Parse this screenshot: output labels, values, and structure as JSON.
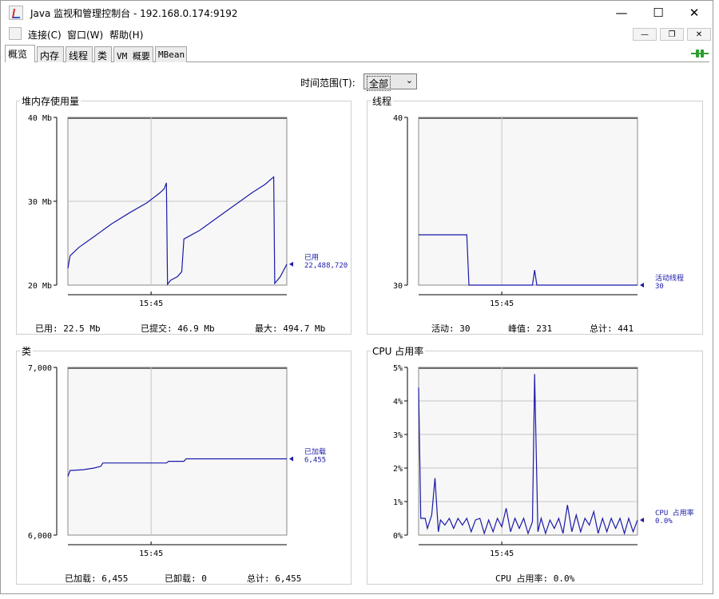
{
  "window": {
    "title": "Java 监视和管理控制台 - 192.168.0.174:9192"
  },
  "titlebar_buttons": {
    "minimize": "—",
    "maximize": "☐",
    "close": "✕"
  },
  "menu": {
    "connect": "连接(C)",
    "window": "窗口(W)",
    "help": "帮助(H)"
  },
  "mdi_buttons": {
    "minimize": "—",
    "restore": "❐",
    "close": "✕"
  },
  "tabs": [
    {
      "label": "概览",
      "active": true
    },
    {
      "label": "内存",
      "active": false
    },
    {
      "label": "线程",
      "active": false
    },
    {
      "label": "类",
      "active": false
    },
    {
      "label": "VM 概要",
      "active": false
    },
    {
      "label": "MBean",
      "active": false
    }
  ],
  "time_range": {
    "label": "时间范围(T):",
    "selected": "全部"
  },
  "colors": {
    "series": "#1a1aa8",
    "plot_bg": "#f7f7f7",
    "grid": "#c6c6c6",
    "connected_icon": "#2f9e2f"
  },
  "panels": {
    "heap": {
      "title": "堆内存使用量",
      "footer": {
        "used": "已用: 22.5 Mb",
        "committed": "已提交: 46.9 Mb",
        "max": "最大: 494.7 Mb"
      },
      "legend": {
        "name": "已用",
        "value": "22,488,720"
      }
    },
    "threads": {
      "title": "线程",
      "footer": {
        "live": "活动: 30",
        "peak": "峰值: 231",
        "total": "总计: 441"
      },
      "legend": {
        "name": "活动线程",
        "value": "30"
      }
    },
    "classes": {
      "title": "类",
      "footer": {
        "loaded": "已加载: 6,455",
        "unloaded": "已卸载: 0",
        "total": "总计: 6,455"
      },
      "legend": {
        "name": "已加载",
        "value": "6,455"
      }
    },
    "cpu": {
      "title": "CPU 占用率",
      "footer": {
        "usage": "CPU 占用率: 0.0%"
      },
      "legend": {
        "name": "CPU 占用率",
        "value": "0.0%"
      }
    }
  },
  "chart_data": [
    {
      "id": "heap",
      "type": "line",
      "title": "堆内存使用量",
      "unit": "Mb",
      "ylim": [
        20,
        40
      ],
      "yticks": [
        20,
        30,
        40
      ],
      "ytick_labels": [
        "20 Mb",
        "30 Mb",
        "40 Mb"
      ],
      "xtick_labels": [
        "15:45"
      ],
      "xtick_positions": [
        0.38
      ],
      "grid": true,
      "series": [
        {
          "name": "已用",
          "points": [
            [
              0,
              22
            ],
            [
              0.01,
              23.5
            ],
            [
              0.05,
              24.5
            ],
            [
              0.12,
              25.8
            ],
            [
              0.2,
              27.3
            ],
            [
              0.28,
              28.6
            ],
            [
              0.36,
              29.8
            ],
            [
              0.42,
              31
            ],
            [
              0.44,
              31.5
            ],
            [
              0.45,
              32.2
            ],
            [
              0.455,
              20.1
            ],
            [
              0.47,
              20.6
            ],
            [
              0.5,
              21
            ],
            [
              0.52,
              21.6
            ],
            [
              0.53,
              25.5
            ],
            [
              0.6,
              26.5
            ],
            [
              0.68,
              28
            ],
            [
              0.76,
              29.5
            ],
            [
              0.84,
              31
            ],
            [
              0.9,
              32
            ],
            [
              0.94,
              32.9
            ],
            [
              0.945,
              20.2
            ],
            [
              0.97,
              21
            ],
            [
              1,
              22.5
            ]
          ]
        }
      ]
    },
    {
      "id": "threads",
      "type": "line",
      "title": "线程",
      "ylim": [
        30,
        40
      ],
      "yticks": [
        30,
        40
      ],
      "ytick_labels": [
        "30",
        "40"
      ],
      "xtick_labels": [
        "15:45"
      ],
      "xtick_positions": [
        0.38
      ],
      "grid": true,
      "series": [
        {
          "name": "活动线程",
          "points": [
            [
              0,
              33
            ],
            [
              0.22,
              33
            ],
            [
              0.23,
              30
            ],
            [
              0.52,
              30
            ],
            [
              0.53,
              30.9
            ],
            [
              0.54,
              30
            ],
            [
              1,
              30
            ]
          ]
        }
      ]
    },
    {
      "id": "classes",
      "type": "line",
      "title": "类",
      "ylim": [
        6000,
        7000
      ],
      "yticks": [
        6000,
        7000
      ],
      "ytick_labels": [
        "6,000",
        "7,000"
      ],
      "xtick_labels": [
        "15:45"
      ],
      "xtick_positions": [
        0.38
      ],
      "grid": true,
      "series": [
        {
          "name": "已加载",
          "points": [
            [
              0,
              6350
            ],
            [
              0.01,
              6385
            ],
            [
              0.07,
              6390
            ],
            [
              0.12,
              6400
            ],
            [
              0.15,
              6410
            ],
            [
              0.16,
              6430
            ],
            [
              0.45,
              6430
            ],
            [
              0.46,
              6440
            ],
            [
              0.53,
              6440
            ],
            [
              0.54,
              6455
            ],
            [
              1,
              6455
            ]
          ]
        }
      ]
    },
    {
      "id": "cpu",
      "type": "line",
      "title": "CPU 占用率",
      "unit": "%",
      "ylim": [
        0,
        5
      ],
      "yticks": [
        0,
        1,
        2,
        3,
        4,
        5
      ],
      "ytick_labels": [
        "0%",
        "1%",
        "2%",
        "3%",
        "4%",
        "5%"
      ],
      "xtick_labels": [
        "15:45"
      ],
      "xtick_positions": [
        0.38
      ],
      "grid": true,
      "series": [
        {
          "name": "CPU 占用率",
          "points": [
            [
              0,
              4.4
            ],
            [
              0.01,
              0.5
            ],
            [
              0.03,
              0.5
            ],
            [
              0.04,
              0.2
            ],
            [
              0.06,
              0.6
            ],
            [
              0.075,
              1.7
            ],
            [
              0.09,
              0.1
            ],
            [
              0.1,
              0.45
            ],
            [
              0.12,
              0.3
            ],
            [
              0.14,
              0.5
            ],
            [
              0.16,
              0.2
            ],
            [
              0.18,
              0.5
            ],
            [
              0.2,
              0.3
            ],
            [
              0.22,
              0.5
            ],
            [
              0.24,
              0.1
            ],
            [
              0.26,
              0.45
            ],
            [
              0.28,
              0.5
            ],
            [
              0.3,
              0.05
            ],
            [
              0.32,
              0.45
            ],
            [
              0.34,
              0.1
            ],
            [
              0.36,
              0.5
            ],
            [
              0.38,
              0.25
            ],
            [
              0.4,
              0.8
            ],
            [
              0.42,
              0.1
            ],
            [
              0.44,
              0.5
            ],
            [
              0.46,
              0.2
            ],
            [
              0.48,
              0.5
            ],
            [
              0.5,
              0.05
            ],
            [
              0.52,
              0.4
            ],
            [
              0.53,
              4.8
            ],
            [
              0.545,
              0.1
            ],
            [
              0.56,
              0.5
            ],
            [
              0.58,
              0.05
            ],
            [
              0.6,
              0.45
            ],
            [
              0.62,
              0.2
            ],
            [
              0.64,
              0.5
            ],
            [
              0.66,
              0.05
            ],
            [
              0.68,
              0.9
            ],
            [
              0.7,
              0.1
            ],
            [
              0.72,
              0.6
            ],
            [
              0.74,
              0.1
            ],
            [
              0.76,
              0.5
            ],
            [
              0.78,
              0.3
            ],
            [
              0.8,
              0.7
            ],
            [
              0.82,
              0.05
            ],
            [
              0.84,
              0.5
            ],
            [
              0.86,
              0.1
            ],
            [
              0.88,
              0.5
            ],
            [
              0.9,
              0.2
            ],
            [
              0.92,
              0.5
            ],
            [
              0.94,
              0.05
            ],
            [
              0.96,
              0.5
            ],
            [
              0.98,
              0.1
            ],
            [
              1,
              0.45
            ]
          ]
        }
      ]
    }
  ]
}
